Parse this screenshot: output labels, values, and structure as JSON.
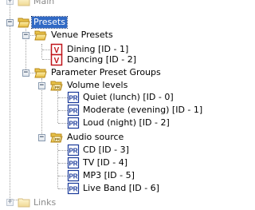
{
  "tree": {
    "main_label": "Main",
    "presets_label": "Presets",
    "venue_presets": {
      "label": "Venue Presets",
      "items": [
        "Dining [ID - 1]",
        "Dancing [ID - 2]"
      ]
    },
    "parameter_preset_groups": {
      "label": "Parameter Preset Groups",
      "volume_levels": {
        "label": "Volume levels",
        "items": [
          "Quiet (lunch) [ID - 0]",
          "Moderate (evening) [ID - 1]",
          "Loud (night) [ID - 2]"
        ]
      },
      "audio_source": {
        "label": "Audio source",
        "items": [
          "CD [ID - 3]",
          "TV [ID - 4]",
          "MP3 [ID - 5]",
          "Live Band [ID - 6]"
        ]
      }
    },
    "links_label": "Links"
  },
  "icons": {
    "venue_preset_letter": "V",
    "parameter_preset_letters": "PR",
    "group_badge_letters": "PR"
  },
  "colors": {
    "selection": "#316ac5",
    "venue_icon_border": "#c0141a",
    "param_icon_border": "#1a3a9a",
    "folder_yellow": "#f5d56a"
  }
}
